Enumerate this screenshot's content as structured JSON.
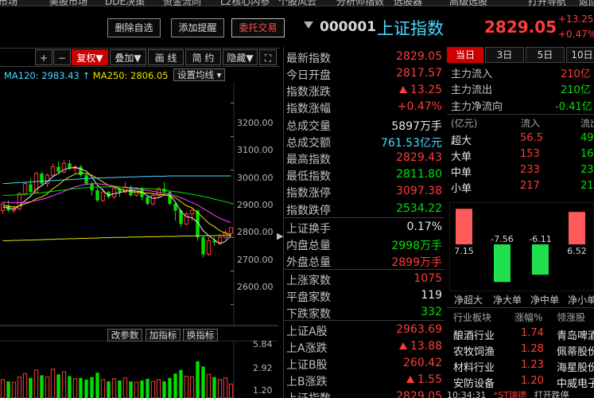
{
  "top_menu": [
    "市场",
    "美股市场",
    "DDE决策",
    "资金流向",
    "L2核心内参",
    "个股风云",
    "分析师指数",
    "选股器",
    "高级选股",
    "打开导航",
    "返回"
  ],
  "buttons": {
    "delete_watch": "删除自选",
    "add_alert": "添加提醒",
    "trade": "委托交易"
  },
  "index": {
    "code": "000001",
    "name": "上证指数",
    "price": "2829.05",
    "change": "+13.25",
    "pct": "+0.47%"
  },
  "toolbar": {
    "plus": "+",
    "minus": "−",
    "fuquan": "复权",
    "overlay": "叠加",
    "draw": "画 线",
    "brief": "简 约",
    "hide": "隐藏"
  },
  "ma_legend": {
    "ma120": "MA120: 2983.43",
    "ma120_arrow": "↑",
    "ma250": "MA250: 2806.05",
    "ma250_arrow": "↑",
    "set_ma": "设置均线"
  },
  "price_axis": [
    "3200.00",
    "3100.00",
    "3000.00",
    "2900.00",
    "2800.00",
    "2700.00",
    "2600.00"
  ],
  "vol_axis": [
    "5.84",
    "2.92",
    "1.20"
  ],
  "indicator_buttons": {
    "change_params": "改参数",
    "add_indicator": "加指标",
    "switch_indicator": "换指标"
  },
  "colors": {
    "up": "#ff3b3b",
    "down": "#00e000",
    "accent": "#4ad8ff",
    "active_tab": "#cc0000"
  },
  "quote": [
    {
      "label": "最新指数",
      "value": "2829.05",
      "color": "red"
    },
    {
      "label": "今日开盘",
      "value": "2817.57",
      "color": "red"
    },
    {
      "label": "指数涨跌",
      "value": "13.25",
      "color": "red",
      "arrow": true
    },
    {
      "label": "指数涨幅",
      "value": "+0.47%",
      "color": "red"
    },
    {
      "label": "总成交量",
      "value": "5897",
      "unit": "万手",
      "color": "white"
    },
    {
      "label": "总成交额",
      "value": "761.53",
      "unit": "亿元",
      "color": "cyan"
    },
    {
      "label": "最高指数",
      "value": "2829.43",
      "color": "red"
    },
    {
      "label": "最低指数",
      "value": "2811.80",
      "color": "green"
    },
    {
      "label": "指数涨停",
      "value": "3097.38",
      "color": "red"
    },
    {
      "label": "指数跌停",
      "value": "2534.22",
      "color": "green"
    },
    {
      "label": "上证换手",
      "value": "0.17%",
      "color": "white"
    },
    {
      "label": "内盘总量",
      "value": "2998",
      "unit": "万手",
      "color": "green"
    },
    {
      "label": "外盘总量",
      "value": "2899",
      "unit": "万手",
      "color": "red"
    },
    {
      "label": "上涨家数",
      "value": "1075",
      "color": "red"
    },
    {
      "label": "平盘家数",
      "value": "119",
      "color": "white"
    },
    {
      "label": "下跌家数",
      "value": "332",
      "color": "green"
    },
    {
      "label": "上证A股",
      "value": "2963.69",
      "color": "red"
    },
    {
      "label": "上A涨跌",
      "value": "13.88",
      "color": "red",
      "arrow": true
    },
    {
      "label": "上证B股",
      "value": "260.42",
      "color": "red"
    },
    {
      "label": "上B涨跌",
      "value": "1.55",
      "color": "red",
      "arrow": true
    },
    {
      "label": "上证指数",
      "value": "2829.05",
      "color": "red"
    }
  ],
  "fund_flow": {
    "tabs": [
      "当日",
      "3日",
      "5日",
      "10日"
    ],
    "main_in_label": "主力流入",
    "main_in_value": "210亿",
    "main_out_label": "主力流出",
    "main_out_value": "210亿",
    "main_net_label": "主力净流向",
    "main_net_value": "-0.41亿",
    "table_header": {
      "unit": "(亿元)",
      "inflow": "流入",
      "outflow": "流出"
    },
    "rows": [
      {
        "label": "超大",
        "inflow": "56.5",
        "outflow": "49."
      },
      {
        "label": "大单",
        "inflow": "153",
        "outflow": "16"
      },
      {
        "label": "中单",
        "inflow": "233",
        "outflow": "23"
      },
      {
        "label": "小单",
        "inflow": "217",
        "outflow": "21"
      }
    ],
    "net_bars": [
      {
        "label": "净超大",
        "value": 7.15
      },
      {
        "label": "净大单",
        "value": -7.56
      },
      {
        "label": "净中单",
        "value": -6.11
      },
      {
        "label": "净小单",
        "value": 6.52
      }
    ],
    "bar_value_labels": [
      "7.15",
      "-7.56",
      "-6.11",
      "6.52"
    ]
  },
  "industry": {
    "header": {
      "name": "行业板块",
      "pct": "涨幅%",
      "leader": "领涨股"
    },
    "rows": [
      {
        "name": "酿酒行业",
        "pct": "1.74",
        "leader": "青岛啤酒"
      },
      {
        "name": "农牧饲渔",
        "pct": "1.28",
        "leader": "佩蒂股份"
      },
      {
        "name": "材料行业",
        "pct": "1.23",
        "leader": "海星股份"
      },
      {
        "name": "安防设备",
        "pct": "1.20",
        "leader": "中威电子"
      }
    ]
  },
  "status_bar": {
    "time": "10:34:31",
    "stock": "*ST瑞德",
    "action": "打开跌停"
  },
  "chart_data": {
    "type": "candlestick",
    "y_range": [
      2540,
      3260
    ],
    "candles": [
      [
        2880,
        2900,
        2870,
        2905
      ],
      [
        2895,
        2880,
        2875,
        2910
      ],
      [
        2880,
        2885,
        2872,
        2895
      ],
      [
        2885,
        2930,
        2880,
        2935
      ],
      [
        2930,
        2960,
        2925,
        2965
      ],
      [
        2958,
        2935,
        2930,
        2975
      ],
      [
        2935,
        2990,
        2930,
        2995
      ],
      [
        2990,
        2960,
        2955,
        2995
      ],
      [
        2960,
        2985,
        2950,
        2990
      ],
      [
        2985,
        3010,
        2980,
        3020
      ],
      [
        3010,
        2995,
        2990,
        3025
      ],
      [
        2995,
        3020,
        2990,
        3030
      ],
      [
        3020,
        3005,
        3000,
        3030
      ],
      [
        3005,
        3010,
        2990,
        3015
      ],
      [
        3010,
        2985,
        2980,
        3015
      ],
      [
        2985,
        2960,
        2955,
        2990
      ],
      [
        2960,
        2940,
        2925,
        2965
      ],
      [
        2940,
        2910,
        2905,
        2950
      ],
      [
        2910,
        2935,
        2905,
        2945
      ],
      [
        2935,
        2920,
        2915,
        2940
      ],
      [
        2920,
        2945,
        2915,
        2950
      ],
      [
        2945,
        2935,
        2920,
        2950
      ],
      [
        2935,
        2950,
        2930,
        2965
      ],
      [
        2950,
        2925,
        2920,
        2955
      ],
      [
        2925,
        2945,
        2920,
        2950
      ],
      [
        2945,
        2920,
        2910,
        2950
      ],
      [
        2920,
        2900,
        2895,
        2925
      ],
      [
        2900,
        2925,
        2895,
        2930
      ],
      [
        2925,
        2945,
        2920,
        2950
      ],
      [
        2945,
        2935,
        2930,
        2965
      ],
      [
        2935,
        2900,
        2895,
        2940
      ],
      [
        2900,
        2880,
        2850,
        2905
      ],
      [
        2880,
        2840,
        2830,
        2885
      ],
      [
        2840,
        2870,
        2835,
        2875
      ],
      [
        2870,
        2880,
        2850,
        2885
      ],
      [
        2880,
        2800,
        2790,
        2880
      ],
      [
        2800,
        2750,
        2740,
        2805
      ],
      [
        2750,
        2790,
        2745,
        2800
      ],
      [
        2790,
        2785,
        2775,
        2800
      ],
      [
        2785,
        2800,
        2780,
        2810
      ],
      [
        2800,
        2815,
        2795,
        2820
      ],
      [
        2812,
        2829,
        2810,
        2830
      ]
    ],
    "ma_lines": [
      {
        "name": "MA5",
        "color": "#e8e8e8",
        "values": [
          2890,
          2888,
          2884,
          2894,
          2910,
          2922,
          2943,
          2954,
          2966,
          2981,
          2990,
          3002,
          3006,
          3008,
          3004,
          2997,
          2980,
          2956,
          2940,
          2925,
          2930,
          2933,
          2938,
          2940,
          2938,
          2935,
          2924,
          2916,
          2918,
          2926,
          2924,
          2906,
          2876,
          2862,
          2858,
          2845,
          2820,
          2805,
          2793,
          2780,
          2789,
          2805
        ]
      },
      {
        "name": "MA10",
        "color": "#e6e600",
        "values": [
          2895,
          2893,
          2890,
          2893,
          2900,
          2905,
          2915,
          2920,
          2930,
          2945,
          2956,
          2970,
          2980,
          2988,
          2992,
          2990,
          2985,
          2975,
          2965,
          2955,
          2950,
          2944,
          2940,
          2936,
          2934,
          2933,
          2932,
          2930,
          2928,
          2927,
          2924,
          2918,
          2906,
          2894,
          2888,
          2874,
          2858,
          2842,
          2832,
          2820,
          2812,
          2808
        ]
      },
      {
        "name": "MA20",
        "color": "#ff40ff",
        "values": [
          2905,
          2904,
          2903,
          2903,
          2904,
          2906,
          2910,
          2913,
          2918,
          2924,
          2930,
          2937,
          2944,
          2950,
          2955,
          2958,
          2960,
          2960,
          2958,
          2955,
          2953,
          2950,
          2948,
          2946,
          2944,
          2942,
          2940,
          2937,
          2934,
          2931,
          2928,
          2924,
          2918,
          2911,
          2904,
          2896,
          2886,
          2876,
          2866,
          2857,
          2850,
          2844
        ]
      },
      {
        "name": "MA60",
        "color": "#00e000",
        "values": [
          2925,
          2925,
          2926,
          2927,
          2928,
          2929,
          2931,
          2933,
          2935,
          2937,
          2939,
          2941,
          2943,
          2945,
          2947,
          2948,
          2949,
          2950,
          2950,
          2950,
          2950,
          2950,
          2949,
          2948,
          2947,
          2946,
          2945,
          2944,
          2942,
          2940,
          2938,
          2936,
          2934,
          2931,
          2928,
          2925,
          2922,
          2918,
          2914,
          2910,
          2906,
          2902
        ]
      },
      {
        "name": "MA120",
        "color": "#4ad8ff",
        "values": [
          2960,
          2961,
          2962,
          2963,
          2964,
          2965,
          2966,
          2967,
          2968,
          2969,
          2970,
          2971,
          2972,
          2973,
          2974,
          2975,
          2976,
          2977,
          2977,
          2978,
          2978,
          2979,
          2979,
          2980,
          2980,
          2981,
          2981,
          2982,
          2982,
          2982,
          2983,
          2983,
          2983,
          2983,
          2983,
          2983,
          2983,
          2983,
          2983,
          2983,
          2983,
          2983
        ]
      },
      {
        "name": "MA250",
        "color": "#e6e600",
        "values": [
          2790,
          2790,
          2791,
          2791,
          2792,
          2792,
          2793,
          2793,
          2794,
          2794,
          2795,
          2795,
          2796,
          2796,
          2797,
          2797,
          2798,
          2798,
          2799,
          2799,
          2800,
          2800,
          2800,
          2801,
          2801,
          2801,
          2802,
          2802,
          2802,
          2803,
          2803,
          2803,
          2804,
          2804,
          2804,
          2805,
          2805,
          2805,
          2805,
          2806,
          2806,
          2806
        ]
      }
    ],
    "volume_range": [
      0,
      6.2
    ],
    "volume": [
      2.1,
      1.9,
      1.8,
      2.4,
      2.8,
      2.3,
      3.2,
      2.6,
      2.4,
      3.3,
      2.7,
      3.0,
      2.5,
      2.2,
      2.3,
      2.1,
      2.4,
      2.9,
      2.1,
      1.9,
      2.2,
      2.0,
      2.3,
      1.9,
      1.8,
      2.0,
      2.2,
      1.9,
      2.1,
      1.9,
      2.3,
      2.8,
      3.2,
      2.5,
      2.4,
      4.2,
      3.6,
      2.7,
      2.4,
      2.1,
      2.3,
      1.6
    ]
  }
}
